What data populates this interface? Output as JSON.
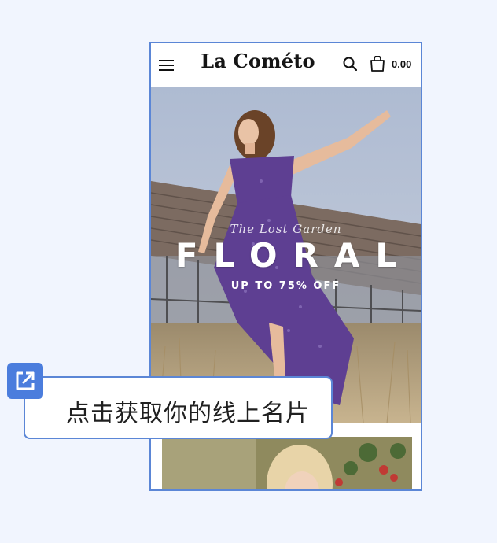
{
  "header": {
    "brand": "La Cométo",
    "cart_total": "0.00",
    "icons": [
      "hamburger-menu-icon",
      "search-icon",
      "shopping-bag-icon"
    ]
  },
  "hero": {
    "script_text": "The Lost Garden",
    "headline": "FLORAL",
    "offer": "UP TO 75% OFF"
  },
  "overlay": {
    "share_icon": "external-link-icon",
    "card_text": "点击获取你的线上名片"
  },
  "colors": {
    "page_bg": "#f1f5fe",
    "accent_blue": "#4b7ddd",
    "frame_border": "#5b86d6",
    "dress_purple": "#5e3f92"
  }
}
